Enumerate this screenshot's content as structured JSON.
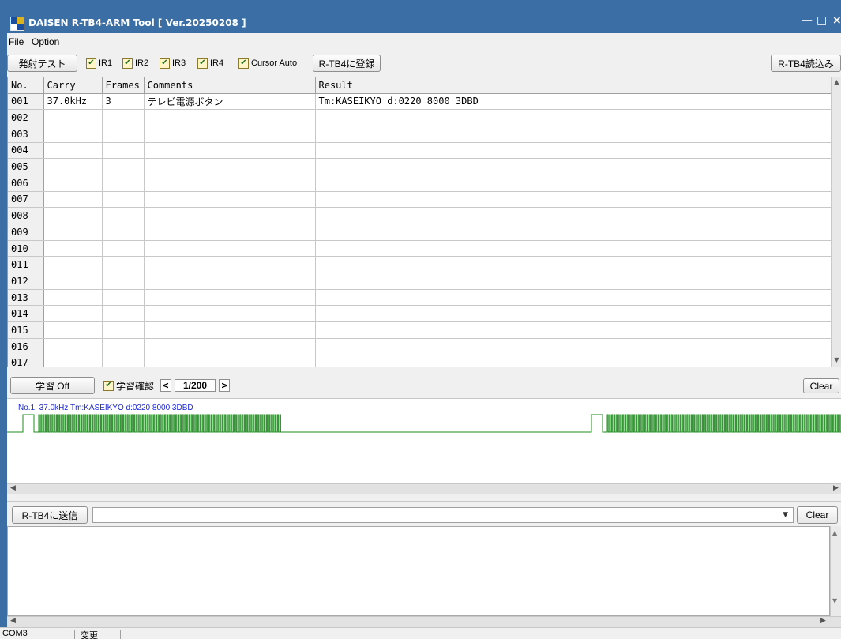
{
  "window": {
    "title": "DAISEN R-TB4-ARM Tool [ Ver.20250208 ]",
    "minimize": "—",
    "maximize": "□",
    "close": "×"
  },
  "menu": {
    "file": "File",
    "option": "Option"
  },
  "toolbar": {
    "emit_test": "発射テスト",
    "ir1": "IR1",
    "ir2": "IR2",
    "ir3": "IR3",
    "ir4": "IR4",
    "cursor_auto": "Cursor Auto",
    "register": "R-TB4に登録",
    "read": "R-TB4読込み"
  },
  "table": {
    "headers": [
      "No.",
      "Carry",
      "Frames",
      "Comments",
      "Result"
    ],
    "rows": [
      [
        "001",
        "37.0kHz",
        "3",
        "テレビ電源ボタン",
        "Tm:KASEIKYO    d:0220 8000 3DBD"
      ],
      [
        "002",
        "",
        "",
        "",
        ""
      ],
      [
        "003",
        "",
        "",
        "",
        ""
      ],
      [
        "004",
        "",
        "",
        "",
        ""
      ],
      [
        "005",
        "",
        "",
        "",
        ""
      ],
      [
        "006",
        "",
        "",
        "",
        ""
      ],
      [
        "007",
        "",
        "",
        "",
        ""
      ],
      [
        "008",
        "",
        "",
        "",
        ""
      ],
      [
        "009",
        "",
        "",
        "",
        ""
      ],
      [
        "010",
        "",
        "",
        "",
        ""
      ],
      [
        "011",
        "",
        "",
        "",
        ""
      ],
      [
        "012",
        "",
        "",
        "",
        ""
      ],
      [
        "013",
        "",
        "",
        "",
        ""
      ],
      [
        "014",
        "",
        "",
        "",
        ""
      ],
      [
        "015",
        "",
        "",
        "",
        ""
      ],
      [
        "016",
        "",
        "",
        "",
        ""
      ],
      [
        "017",
        "",
        "",
        "",
        ""
      ]
    ]
  },
  "learn": {
    "learn_button": "学習 Off",
    "confirm": "学習確認",
    "prev": "<",
    "page": "1/200",
    "next": ">",
    "clear": "Clear"
  },
  "waveform": {
    "label": "No.1: 37.0kHz Tm:KASEIKYO   d:0220 8000 3DBD",
    "color": "#1e8c1e"
  },
  "send": {
    "send_button": "R-TB4に送信",
    "combo_value": "",
    "clear": "Clear"
  },
  "status": {
    "port": "COM3",
    "changed": "変更"
  },
  "colors": {
    "titlebar": "#3a6ea5",
    "label_blue": "#1c28d6",
    "wave_green": "#1e8c1e"
  }
}
